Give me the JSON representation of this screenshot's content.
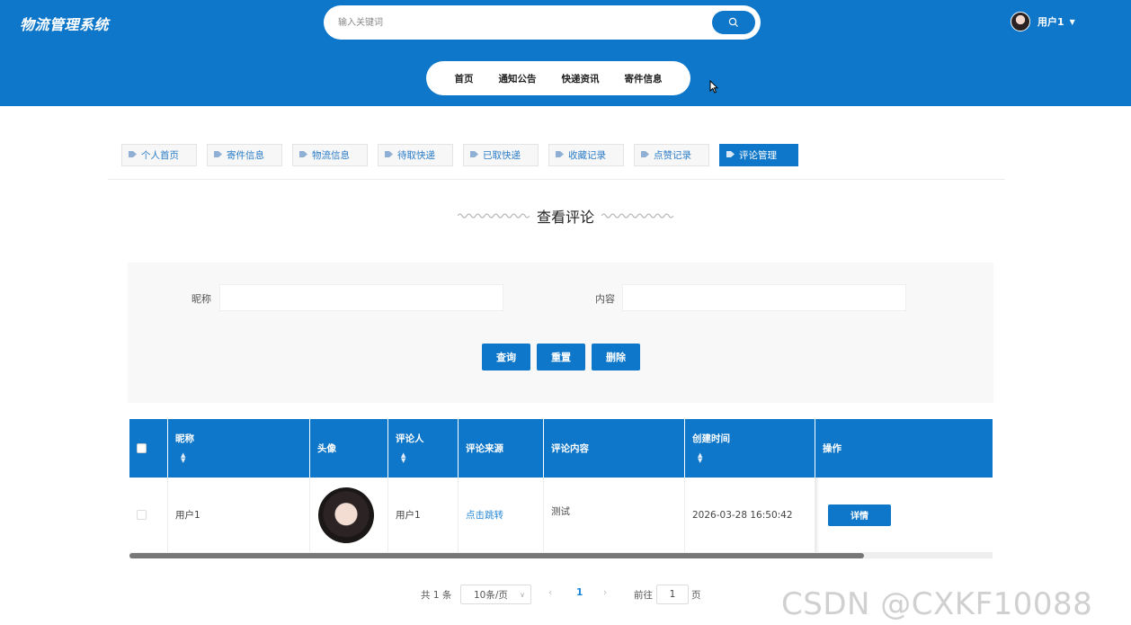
{
  "header": {
    "logo": "物流管理系统",
    "search_placeholder": "输入关键词",
    "user_name": "用户1",
    "nav": [
      "首页",
      "通知公告",
      "快递资讯",
      "寄件信息"
    ]
  },
  "tabs": [
    "个人首页",
    "寄件信息",
    "物流信息",
    "待取快递",
    "已取快递",
    "收藏记录",
    "点赞记录",
    "评论管理"
  ],
  "active_tab": "评论管理",
  "page_title": "查看评论",
  "filter": {
    "nickname_label": "昵称",
    "content_label": "内容",
    "buttons": [
      "查询",
      "重置",
      "删除"
    ]
  },
  "table": {
    "columns": [
      "昵称",
      "头像",
      "评论人",
      "评论来源",
      "评论内容",
      "创建时间",
      "操作"
    ],
    "rows": [
      {
        "nickname": "用户1",
        "commenter": "用户1",
        "source": "点击跳转",
        "content": "测试",
        "created": "2026-03-28 16:50:42",
        "action": "详情"
      }
    ]
  },
  "pagination": {
    "total": "共 1 条",
    "page_size": "10条/页",
    "current_page": "1",
    "goto_label": "前往",
    "goto_value": "1",
    "page_unit": "页"
  },
  "watermark": "CSDN @CXKF10088",
  "colors": {
    "primary": "#0e77c9",
    "link": "#2a8ad7"
  }
}
